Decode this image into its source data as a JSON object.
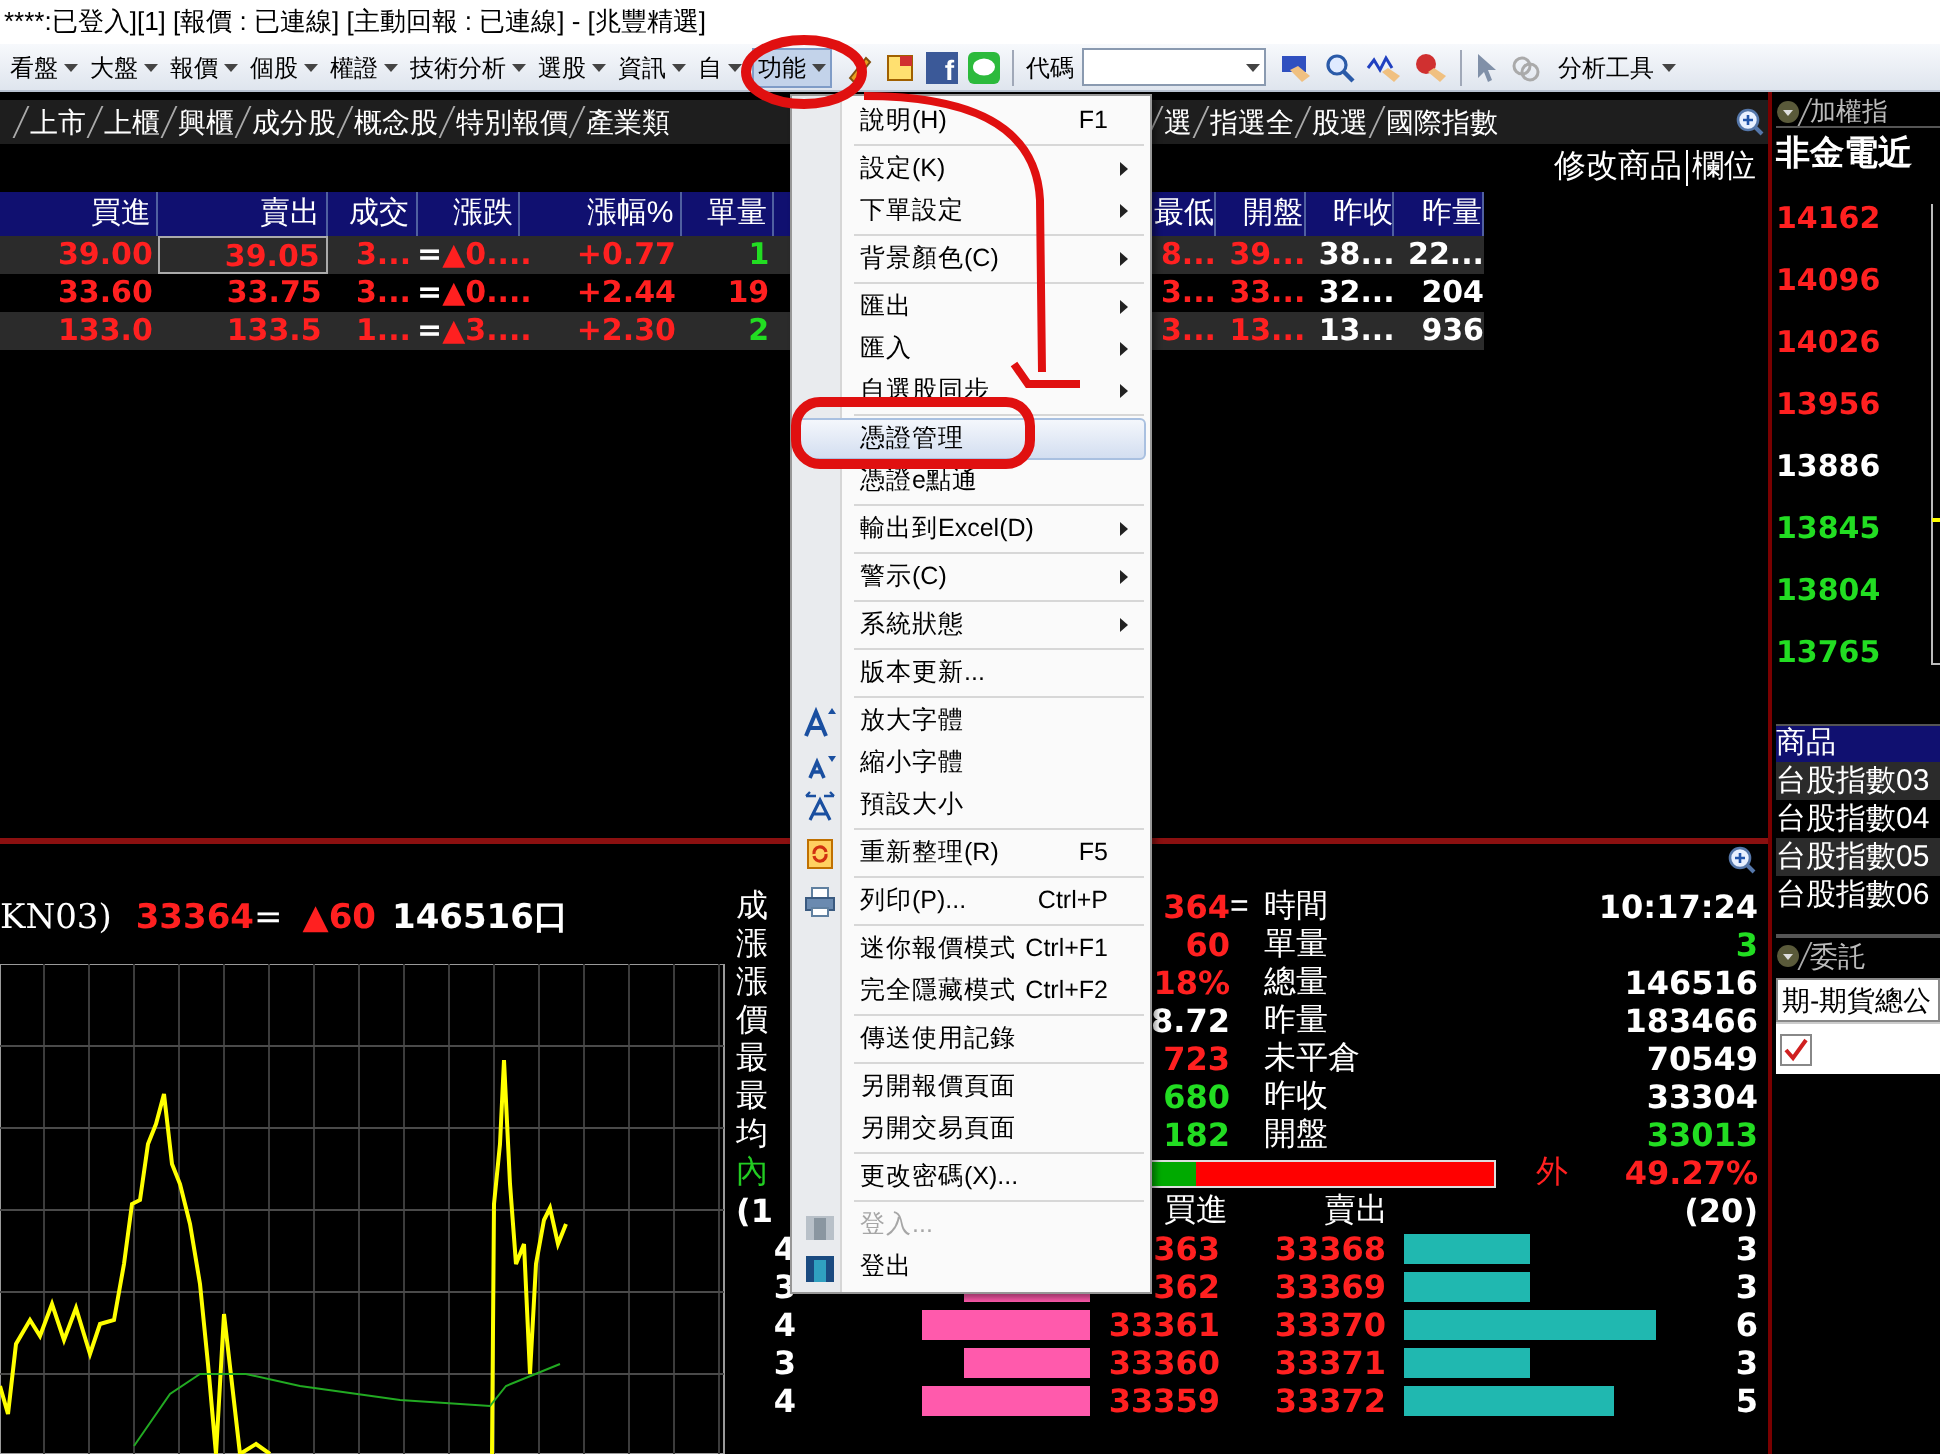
{
  "window": {
    "title": "****:已登入][1] [報價 : 已連線] [主動回報 : 已連線] - [兆豐精選]"
  },
  "toolbar": {
    "menus": [
      {
        "label": "看盤",
        "selected": false
      },
      {
        "label": "大盤",
        "selected": false
      },
      {
        "label": "報價",
        "selected": false
      },
      {
        "label": "個股",
        "selected": false
      },
      {
        "label": "權證",
        "selected": false
      },
      {
        "label": "技術分析",
        "selected": false
      },
      {
        "label": "選股",
        "selected": false
      },
      {
        "label": "資訊",
        "selected": false
      },
      {
        "label": "自",
        "selected": false
      },
      {
        "label": "功能",
        "selected": true
      }
    ],
    "logo_letter": "f",
    "code_label": "代碼",
    "analysis_label": "分析工具"
  },
  "quote_tabs_left": [
    "上市",
    "上櫃",
    "興櫃",
    "成分股",
    "概念股",
    "特別報價",
    "產業類"
  ],
  "quote_tabs_right": [
    "選",
    "指選全",
    "股選",
    "國際指數"
  ],
  "quote_actions": [
    "修改商品",
    "欄位"
  ],
  "table": {
    "columns_left": [
      "買進",
      "賣出",
      "成交",
      "漲跌",
      "漲幅%",
      "單量"
    ],
    "columns_right": [
      "最低",
      "開盤",
      "昨收",
      "昨量"
    ],
    "rows": [
      {
        "bid": "39.00",
        "ask": "39.05",
        "last": "3...",
        "tick": "=",
        "change": "▲0....",
        "change_pct": "+0.77",
        "volume": {
          "value": "1",
          "color": "#22dd22"
        },
        "low": "8...",
        "open": "39...",
        "prev_close": "38...",
        "prev_volume": "22...",
        "selected": true
      },
      {
        "bid": "33.60",
        "ask": "33.75",
        "last": "3...",
        "tick": "=",
        "change": "▲0....",
        "change_pct": "+2.44",
        "volume": {
          "value": "19",
          "color": "#ff2020"
        },
        "low": "3...",
        "open": "33...",
        "prev_close": "32...",
        "prev_volume": "204",
        "selected": false
      },
      {
        "bid": "133.0",
        "ask": "133.5",
        "last": "1...",
        "tick": "=",
        "change": "▲3....",
        "change_pct": "+2.30",
        "volume": {
          "value": "2",
          "color": "#22dd22"
        },
        "low": "3...",
        "open": "13...",
        "prev_close": "13...",
        "prev_volume": "936",
        "selected": false
      }
    ]
  },
  "contract": {
    "name": "KN03)",
    "price": "33364",
    "tick": "=",
    "change": "▲60",
    "volume": "146516口"
  },
  "stats_left": [
    {
      "label": "成",
      "value": "364",
      "tick": "=",
      "color": "#ff2020"
    },
    {
      "label": "漲",
      "value": "60",
      "color": "#ff2020"
    },
    {
      "label": "漲",
      "value": "18%",
      "color": "#ff2020"
    },
    {
      "label": "價",
      "value": "8.72",
      "color": "#ffffff"
    },
    {
      "label": "最",
      "value": "723",
      "color": "#ff2020"
    },
    {
      "label": "最",
      "value": "680",
      "color": "#22dd22"
    },
    {
      "label": "均",
      "value": "182",
      "color": "#22dd22"
    }
  ],
  "stats_right": [
    {
      "label": "時間",
      "value": "10:17:24",
      "color": "#ffffff"
    },
    {
      "label": "單量",
      "value": "3",
      "color": "#22dd22"
    },
    {
      "label": "總量",
      "value": "146516",
      "color": "#ffffff"
    },
    {
      "label": "昨量",
      "value": "183466",
      "color": "#ffffff"
    },
    {
      "label": "未平倉",
      "value": "70549",
      "color": "#ffffff"
    },
    {
      "label": "昨收",
      "value": "33304",
      "color": "#ffffff"
    },
    {
      "label": "開盤",
      "value": "33013",
      "color": "#22dd22"
    }
  ],
  "pressure": {
    "inner_label": "內",
    "level": 0.5073,
    "outer_label": "外",
    "outer_value": "49.27%"
  },
  "order_book": {
    "bid_count": "(1",
    "bid_header": "買進",
    "ask_header": "賣出",
    "ask_count": "(20)",
    "rows": [
      {
        "bid_qty": "4",
        "bid": "363",
        "ask": "33368",
        "ask_qty": "3"
      },
      {
        "bid_qty": "3",
        "bid": "362",
        "ask": "33369",
        "ask_qty": "3"
      },
      {
        "bid_qty": "4",
        "bid": "33361",
        "ask": "33370",
        "ask_qty": "6"
      },
      {
        "bid_qty": "3",
        "bid": "33360",
        "ask": "33371",
        "ask_qty": "3"
      },
      {
        "bid_qty": "4",
        "bid": "33359",
        "ask": "33372",
        "ask_qty": "5"
      }
    ]
  },
  "index_panel": {
    "tab": "加權指",
    "title": "非金電近",
    "levels": [
      {
        "label": "14162",
        "color": "#ff2020"
      },
      {
        "label": "14096",
        "color": "#ff2020"
      },
      {
        "label": "14026",
        "color": "#ff2020"
      },
      {
        "label": "13956",
        "color": "#ff2020"
      },
      {
        "label": "13886",
        "color": "#ffffff"
      },
      {
        "label": "13845",
        "color": "#22dd22"
      },
      {
        "label": "13804",
        "color": "#22dd22"
      },
      {
        "label": "13765",
        "color": "#22dd22"
      }
    ]
  },
  "products": {
    "header": "商品",
    "rows": [
      "台股指數03",
      "台股指數04",
      "台股指數05",
      "台股指數06"
    ]
  },
  "orders_panel": {
    "tab": "委託",
    "account": "期-期貨總公",
    "checked": true
  },
  "menu": {
    "groups": [
      [
        {
          "kind": "plain",
          "label": "說明(H)",
          "shortcut": "F1",
          "submenu": false,
          "selected": false,
          "disabled": false
        }
      ],
      [
        {
          "kind": "plain",
          "label": "設定(K)",
          "submenu": true,
          "selected": false,
          "disabled": false
        },
        {
          "kind": "plain",
          "label": "下單設定",
          "submenu": true,
          "selected": false,
          "disabled": false
        }
      ],
      [
        {
          "kind": "plain",
          "label": "背景顏色(C)",
          "submenu": true,
          "selected": false,
          "disabled": false
        }
      ],
      [
        {
          "kind": "plain",
          "label": "匯出",
          "submenu": true,
          "selected": false,
          "disabled": false
        },
        {
          "kind": "plain",
          "label": "匯入",
          "submenu": true,
          "selected": false,
          "disabled": false
        },
        {
          "kind": "plain",
          "label": "自選股同步",
          "submenu": true,
          "selected": false,
          "disabled": false
        }
      ],
      [
        {
          "kind": "plain",
          "label": "憑證管理",
          "submenu": false,
          "selected": true,
          "disabled": false
        },
        {
          "kind": "plain",
          "label": "憑證e點通",
          "submenu": false,
          "selected": false,
          "disabled": false
        }
      ],
      [
        {
          "kind": "plain",
          "label": "輸出到Excel(D)",
          "submenu": true,
          "selected": false,
          "disabled": false
        }
      ],
      [
        {
          "kind": "plain",
          "label": "警示(C)",
          "submenu": true,
          "selected": false,
          "disabled": false
        }
      ],
      [
        {
          "kind": "plain",
          "label": "系統狀態",
          "submenu": true,
          "selected": false,
          "disabled": false
        }
      ],
      [
        {
          "kind": "plain",
          "label": "版本更新...",
          "submenu": false,
          "selected": false,
          "disabled": false
        }
      ],
      [
        {
          "kind": "larger",
          "label": "放大字體",
          "submenu": false,
          "selected": false,
          "disabled": false
        },
        {
          "kind": "smaller",
          "label": "縮小字體",
          "submenu": false,
          "selected": false,
          "disabled": false
        },
        {
          "kind": "resize",
          "label": "預設大小",
          "submenu": false,
          "selected": false,
          "disabled": false
        }
      ],
      [
        {
          "kind": "refresh",
          "label": "重新整理(R)",
          "shortcut": "F5",
          "submenu": false,
          "selected": false,
          "disabled": false
        }
      ],
      [
        {
          "kind": "print",
          "label": "列印(P)...",
          "shortcut": "Ctrl+P",
          "submenu": false,
          "selected": false,
          "disabled": false
        }
      ],
      [
        {
          "kind": "plain",
          "label": "迷你報價模式",
          "shortcut": "Ctrl+F1",
          "submenu": false,
          "selected": false,
          "disabled": false
        },
        {
          "kind": "plain",
          "label": "完全隱藏模式",
          "shortcut": "Ctrl+F2",
          "submenu": false,
          "selected": false,
          "disabled": false
        }
      ],
      [
        {
          "kind": "plain",
          "label": "傳送使用記錄",
          "submenu": false,
          "selected": false,
          "disabled": false
        }
      ],
      [
        {
          "kind": "plain",
          "label": "另開報價頁面",
          "submenu": false,
          "selected": false,
          "disabled": false
        },
        {
          "kind": "plain",
          "label": "另開交易頁面",
          "submenu": false,
          "selected": false,
          "disabled": false
        }
      ],
      [
        {
          "kind": "plain",
          "label": "更改密碼(X)...",
          "submenu": false,
          "selected": false,
          "disabled": false
        }
      ],
      [
        {
          "kind": "login",
          "label": "登入...",
          "submenu": false,
          "selected": false,
          "disabled": true
        },
        {
          "kind": "logout",
          "label": "登出",
          "submenu": false,
          "selected": false,
          "disabled": false
        }
      ]
    ]
  }
}
